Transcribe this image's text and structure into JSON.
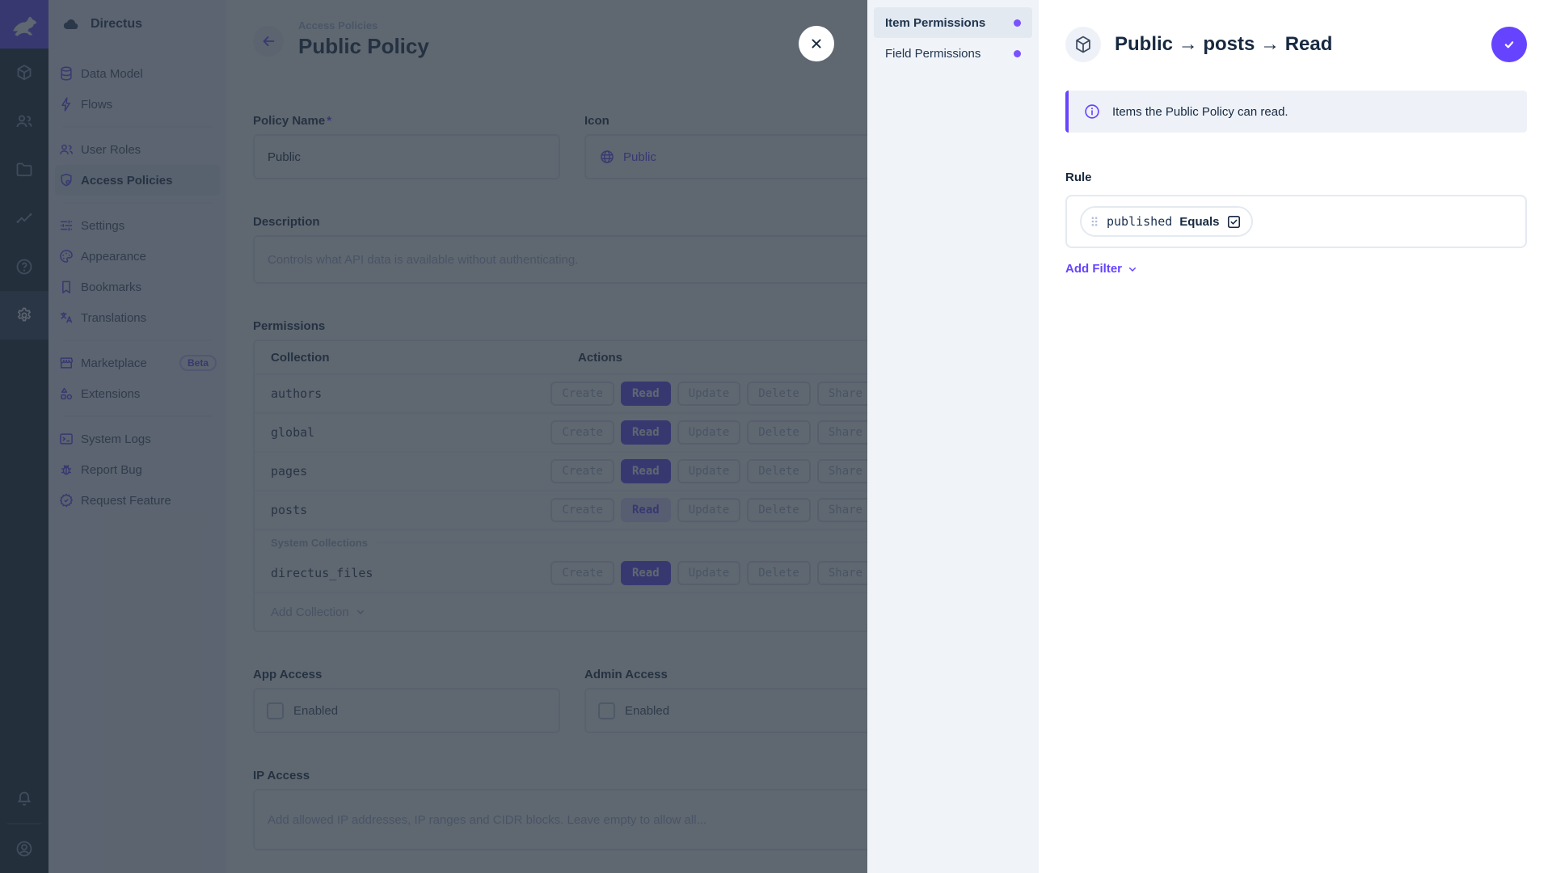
{
  "colors": {
    "primary": "#6644FF",
    "module_bar_bg": "#16212E",
    "nav_bg": "#F0F4F9",
    "overlay": "rgba(42,52,66,0.75)"
  },
  "nav": {
    "project_name": "Directus",
    "sections": [
      {
        "items": [
          {
            "label": "Data Model"
          },
          {
            "label": "Flows"
          }
        ]
      },
      {
        "items": [
          {
            "label": "User Roles"
          },
          {
            "label": "Access Policies"
          }
        ]
      },
      {
        "items": [
          {
            "label": "Settings"
          },
          {
            "label": "Appearance"
          },
          {
            "label": "Bookmarks"
          },
          {
            "label": "Translations"
          }
        ]
      },
      {
        "items": [
          {
            "label": "Marketplace",
            "badge": "Beta"
          },
          {
            "label": "Extensions"
          }
        ]
      },
      {
        "items": [
          {
            "label": "System Logs"
          },
          {
            "label": "Report Bug"
          },
          {
            "label": "Request Feature"
          }
        ]
      }
    ]
  },
  "page": {
    "breadcrumb": "Access Policies",
    "title": "Public Policy",
    "policy_name": {
      "label": "Policy Name",
      "required_marker": "*",
      "value": "Public"
    },
    "icon_field": {
      "label": "Icon",
      "value": "Public"
    },
    "description": {
      "label": "Description",
      "placeholder": "Controls what API data is available without authenticating."
    },
    "permissions": {
      "label": "Permissions",
      "col_collection": "Collection",
      "col_actions": "Actions",
      "actions": [
        "Create",
        "Read",
        "Update",
        "Delete",
        "Share"
      ],
      "rows": [
        {
          "collection": "authors",
          "read": "full"
        },
        {
          "collection": "global",
          "read": "full"
        },
        {
          "collection": "pages",
          "read": "full"
        },
        {
          "collection": "posts",
          "read": "custom"
        }
      ],
      "system_label": "System Collections",
      "system_rows": [
        {
          "collection": "directus_files",
          "read": "full"
        }
      ],
      "add_collection": "Add Collection"
    },
    "app_access": {
      "label": "App Access",
      "checkbox": "Enabled",
      "checked": false
    },
    "admin_access": {
      "label": "Admin Access",
      "checkbox": "Enabled",
      "checked": false
    },
    "ip_access": {
      "label": "IP Access",
      "placeholder": "Add allowed IP addresses, IP ranges and CIDR blocks. Leave empty to allow all..."
    }
  },
  "drawer": {
    "tabs": [
      {
        "label": "Item Permissions"
      },
      {
        "label": "Field Permissions"
      }
    ],
    "title": "Public → posts → Read",
    "notice": "Items the Public Policy can read.",
    "rule_label": "Rule",
    "filter": {
      "field": "published",
      "operator": "Equals",
      "value_checked": true
    },
    "add_filter": "Add Filter"
  }
}
